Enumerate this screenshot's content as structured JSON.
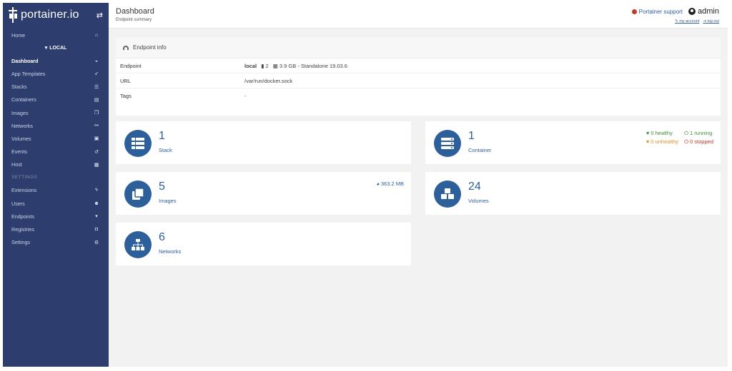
{
  "sidebar": {
    "brand": "portainer.io",
    "toggle_icon": "swap-arrows-icon",
    "home_label": "Home",
    "endpoint_label": "LOCAL",
    "items": [
      {
        "label": "Dashboard",
        "icon": "tachometer-icon"
      },
      {
        "label": "App Templates",
        "icon": "rocket-icon"
      },
      {
        "label": "Stacks",
        "icon": "th-list-icon"
      },
      {
        "label": "Containers",
        "icon": "server-icon"
      },
      {
        "label": "Images",
        "icon": "clone-icon"
      },
      {
        "label": "Networks",
        "icon": "sitemap-icon"
      },
      {
        "label": "Volumes",
        "icon": "cubes-icon"
      },
      {
        "label": "Events",
        "icon": "history-icon"
      },
      {
        "label": "Host",
        "icon": "th-icon"
      }
    ],
    "settings_section": "SETTINGS",
    "settings_items": [
      {
        "label": "Extensions",
        "icon": "bolt-icon"
      },
      {
        "label": "Users",
        "icon": "users-icon"
      },
      {
        "label": "Endpoints",
        "icon": "plug-icon"
      },
      {
        "label": "Registries",
        "icon": "database-icon"
      },
      {
        "label": "Settings",
        "icon": "cogs-icon"
      }
    ]
  },
  "header": {
    "title": "Dashboard",
    "subtitle": "Endpoint summary",
    "support_label": "Portainer support",
    "username": "admin",
    "my_account": "my account",
    "log_out": "log out"
  },
  "endpoint_info": {
    "title": "Endpoint info",
    "rows": [
      {
        "key": "Endpoint",
        "name": "local",
        "cpu": "2",
        "memory": "3.9 GB",
        "mode": "- Standalone 19.03.6"
      },
      {
        "key": "URL",
        "value": "/var/run/docker.sock"
      },
      {
        "key": "Tags",
        "value": "-"
      }
    ]
  },
  "stats": {
    "stacks": {
      "count": "1",
      "label": "Stack"
    },
    "containers": {
      "count": "1",
      "label": "Container",
      "healthy": "0 healthy",
      "running": "1 running",
      "unhealthy": "0 unhealthy",
      "stopped": "0 stopped"
    },
    "images": {
      "count": "5",
      "label": "Images",
      "size": "363.2 MB"
    },
    "volumes": {
      "count": "24",
      "label": "Volumes"
    },
    "networks": {
      "count": "6",
      "label": "Networks"
    }
  },
  "colors": {
    "sidebar": "#2d3e6e",
    "accent": "#2d5f9a",
    "healthy": "#3c8d3c",
    "unhealthy": "#d99229",
    "stopped": "#c0392b"
  }
}
